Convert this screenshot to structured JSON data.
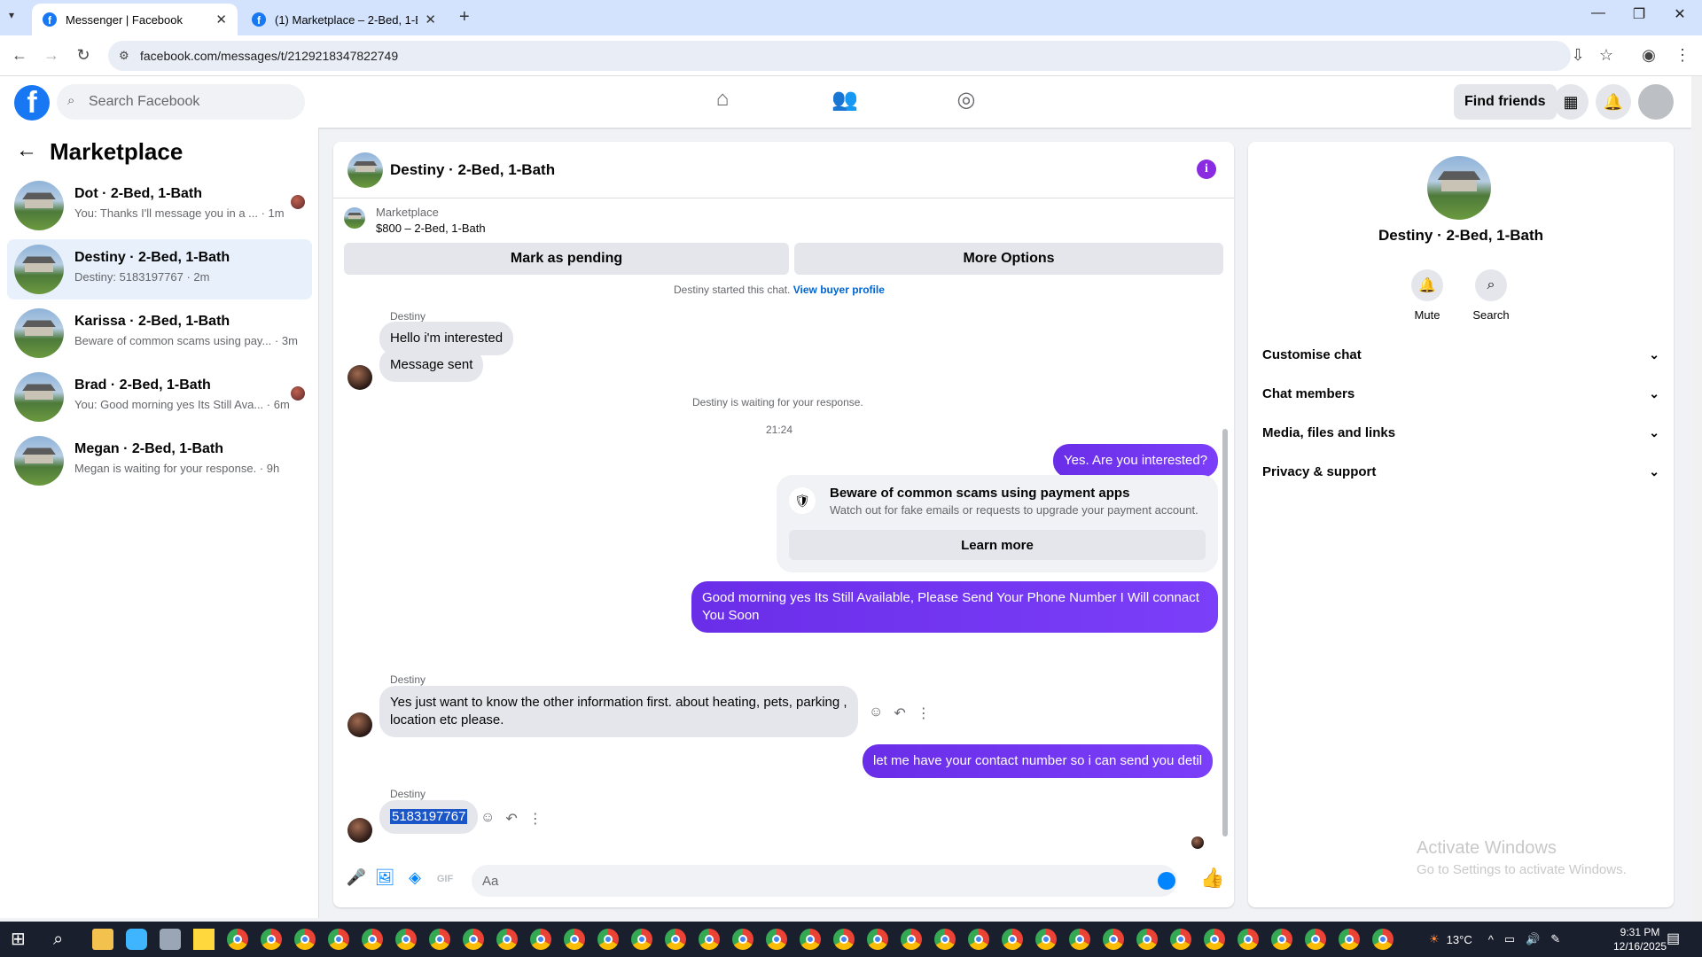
{
  "browser": {
    "tabs": [
      {
        "title": "Messenger | Facebook",
        "active": true
      },
      {
        "title": "(1) Marketplace – 2-Bed, 1-Bath",
        "active": false
      }
    ],
    "url": "facebook.com/messages/t/2129218347822749"
  },
  "fb_header": {
    "search_placeholder": "Search Facebook",
    "find_friends": "Find friends"
  },
  "left": {
    "title": "Marketplace",
    "conversations": [
      {
        "title": "Dot · 2-Bed, 1-Bath",
        "preview": "You: Thanks I'll message you in a ... · 1m",
        "selected": false,
        "seen_avatar": true
      },
      {
        "title": "Destiny · 2-Bed, 1-Bath",
        "preview": "Destiny: 5183197767 · 2m",
        "selected": true,
        "seen_avatar": false
      },
      {
        "title": "Karissa · 2-Bed, 1-Bath",
        "preview": "Beware of common scams using pay... · 3m",
        "selected": false,
        "seen_avatar": false
      },
      {
        "title": "Brad · 2-Bed, 1-Bath",
        "preview": "You: Good morning yes Its Still Ava... · 6m",
        "selected": false,
        "seen_avatar": true
      },
      {
        "title": "Megan · 2-Bed, 1-Bath",
        "preview": "Megan is waiting for your response. · 9h",
        "selected": false,
        "seen_avatar": false
      }
    ]
  },
  "chat": {
    "title": "Destiny · 2-Bed, 1-Bath",
    "marketplace_label": "Marketplace",
    "listing_price": "$800 – 2-Bed, 1-Bath",
    "mark_pending": "Mark as pending",
    "more_options": "More Options",
    "started_text": "Destiny started this chat.",
    "view_buyer": "View buyer profile",
    "sender_name": "Destiny",
    "msg_interested": "Hello i'm interested",
    "msg_sent": "Message sent",
    "waiting_text": "Destiny is waiting for your response.",
    "timestamp": "21:24",
    "out_1": "Yes. Are you interested?",
    "scam_title": "Beware of common scams using payment apps",
    "scam_sub": "Watch out for fake emails or requests to upgrade your payment account.",
    "learn_more": "Learn more",
    "out_2": "Good morning yes  Its Still Available, Please Send Your Phone Number I Will connact You Soon",
    "in_3": "Yes just want to know the other information first. about heating, pets, parking , location etc please.",
    "out_3": "let me have your contact number so i can send you detil",
    "in_4": "5183197767",
    "composer_placeholder": "Aa"
  },
  "right": {
    "name": "Destiny · 2-Bed, 1-Bath",
    "mute": "Mute",
    "search": "Search",
    "sections": [
      "Customise chat",
      "Chat members",
      "Media, files and links",
      "Privacy & support"
    ],
    "activate_title": "Activate Windows",
    "activate_sub": "Go to Settings to activate Windows."
  },
  "taskbar": {
    "weather": "13°C",
    "time": "9:31 PM",
    "date": "12/16/2025"
  },
  "colors": {
    "fb_blue": "#1877f2",
    "outgoing_bubble": "#7b3ef9",
    "selection": "#1a56c7"
  }
}
